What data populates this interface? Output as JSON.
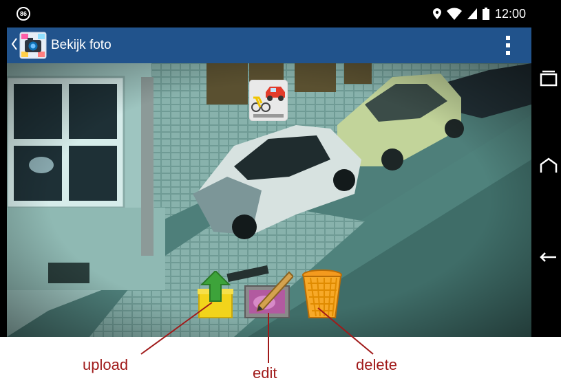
{
  "status_bar": {
    "notification_badge": "86",
    "time": "12:00",
    "icons": [
      "location-icon",
      "wifi-icon",
      "signal-icon",
      "battery-icon"
    ]
  },
  "action_bar": {
    "title": "Bekijk foto",
    "icons": [
      "back-chevron-icon",
      "app-icon",
      "overflow-menu-icon"
    ]
  },
  "photo": {
    "overlay_icon": "car-type-icon"
  },
  "photo_actions": [
    {
      "name": "upload",
      "icon": "upload-icon"
    },
    {
      "name": "edit",
      "icon": "edit-icon"
    },
    {
      "name": "delete",
      "icon": "trash-icon"
    }
  ],
  "annotations": {
    "upload": "upload",
    "edit": "edit",
    "delete": "delete"
  },
  "navigation_bar": {
    "icons": [
      "recents-icon",
      "home-icon",
      "back-icon"
    ]
  },
  "colors": {
    "action_bar": "#21538c",
    "status_bar": "#000000",
    "annotation": "#a01a1a",
    "photo_tint": "#3b6e68"
  }
}
